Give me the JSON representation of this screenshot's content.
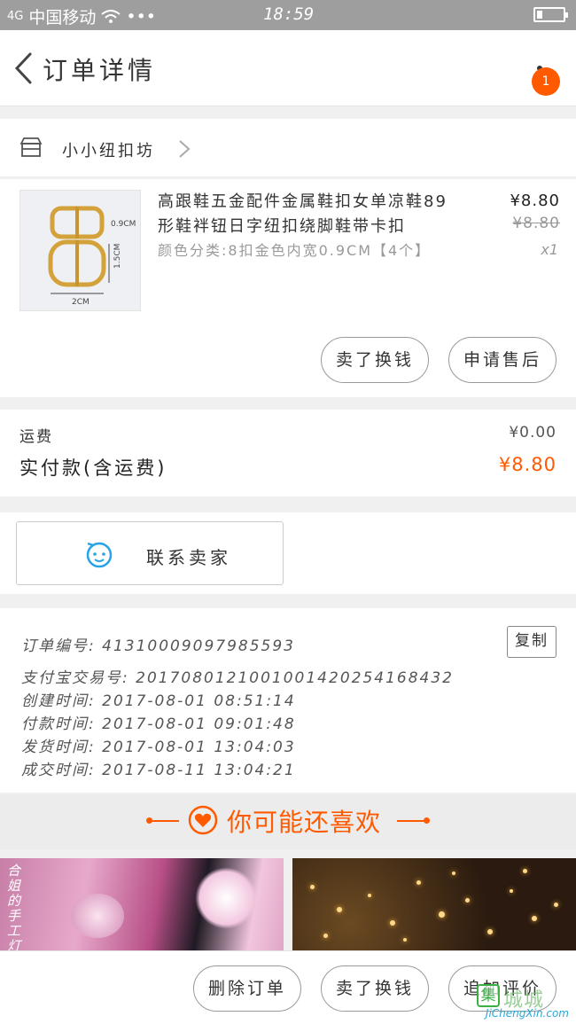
{
  "status_bar": {
    "signal": "4G",
    "carrier": "中国移动",
    "dots": "•••",
    "time": "18:59"
  },
  "header": {
    "title": "订单详情",
    "badge": "1"
  },
  "shop": {
    "name": "小小纽扣坊"
  },
  "product": {
    "title": "高跟鞋五金配件金属鞋扣女单凉鞋89形鞋袢钮日字纽扣绕脚鞋带卡扣",
    "spec": "颜色分类:8扣金色内宽0.9CM【4个】",
    "price": "¥8.80",
    "original_price": "¥8.80",
    "quantity": "x1",
    "image_labels": {
      "height": "0.9CM",
      "side": "1.5CM",
      "width": "2CM"
    },
    "buttons": {
      "exchange": "卖了换钱",
      "after_sale": "申请售后"
    }
  },
  "fees": {
    "shipping_label": "运费",
    "shipping_value": "¥0.00",
    "paid_label": "实付款(含运费)",
    "paid_value": "¥8.80"
  },
  "contact": {
    "label": "联系卖家"
  },
  "order_info": {
    "copy_label": "复制",
    "lines": [
      "订单编号: 41310009097985593",
      "支付宝交易号: 2017080121001001420254168432",
      "创建时间: 2017-08-01 08:51:14",
      "付款时间: 2017-08-01 09:01:48",
      "发货时间: 2017-08-01 13:04:03",
      "成交时间: 2017-08-11 13:04:21"
    ]
  },
  "recommend": {
    "title": "你可能还喜欢",
    "left_caption": "合姐的手工灯"
  },
  "bottom_actions": {
    "delete": "删除订单",
    "exchange": "卖了换钱",
    "review": "追加评价"
  },
  "watermark": {
    "cn": "城城",
    "url": "JiChengXin.com",
    "box": "集"
  },
  "colors": {
    "accent": "#ff5a00",
    "status_bar": "#9e9e9e",
    "background": "#f0f0f0"
  }
}
